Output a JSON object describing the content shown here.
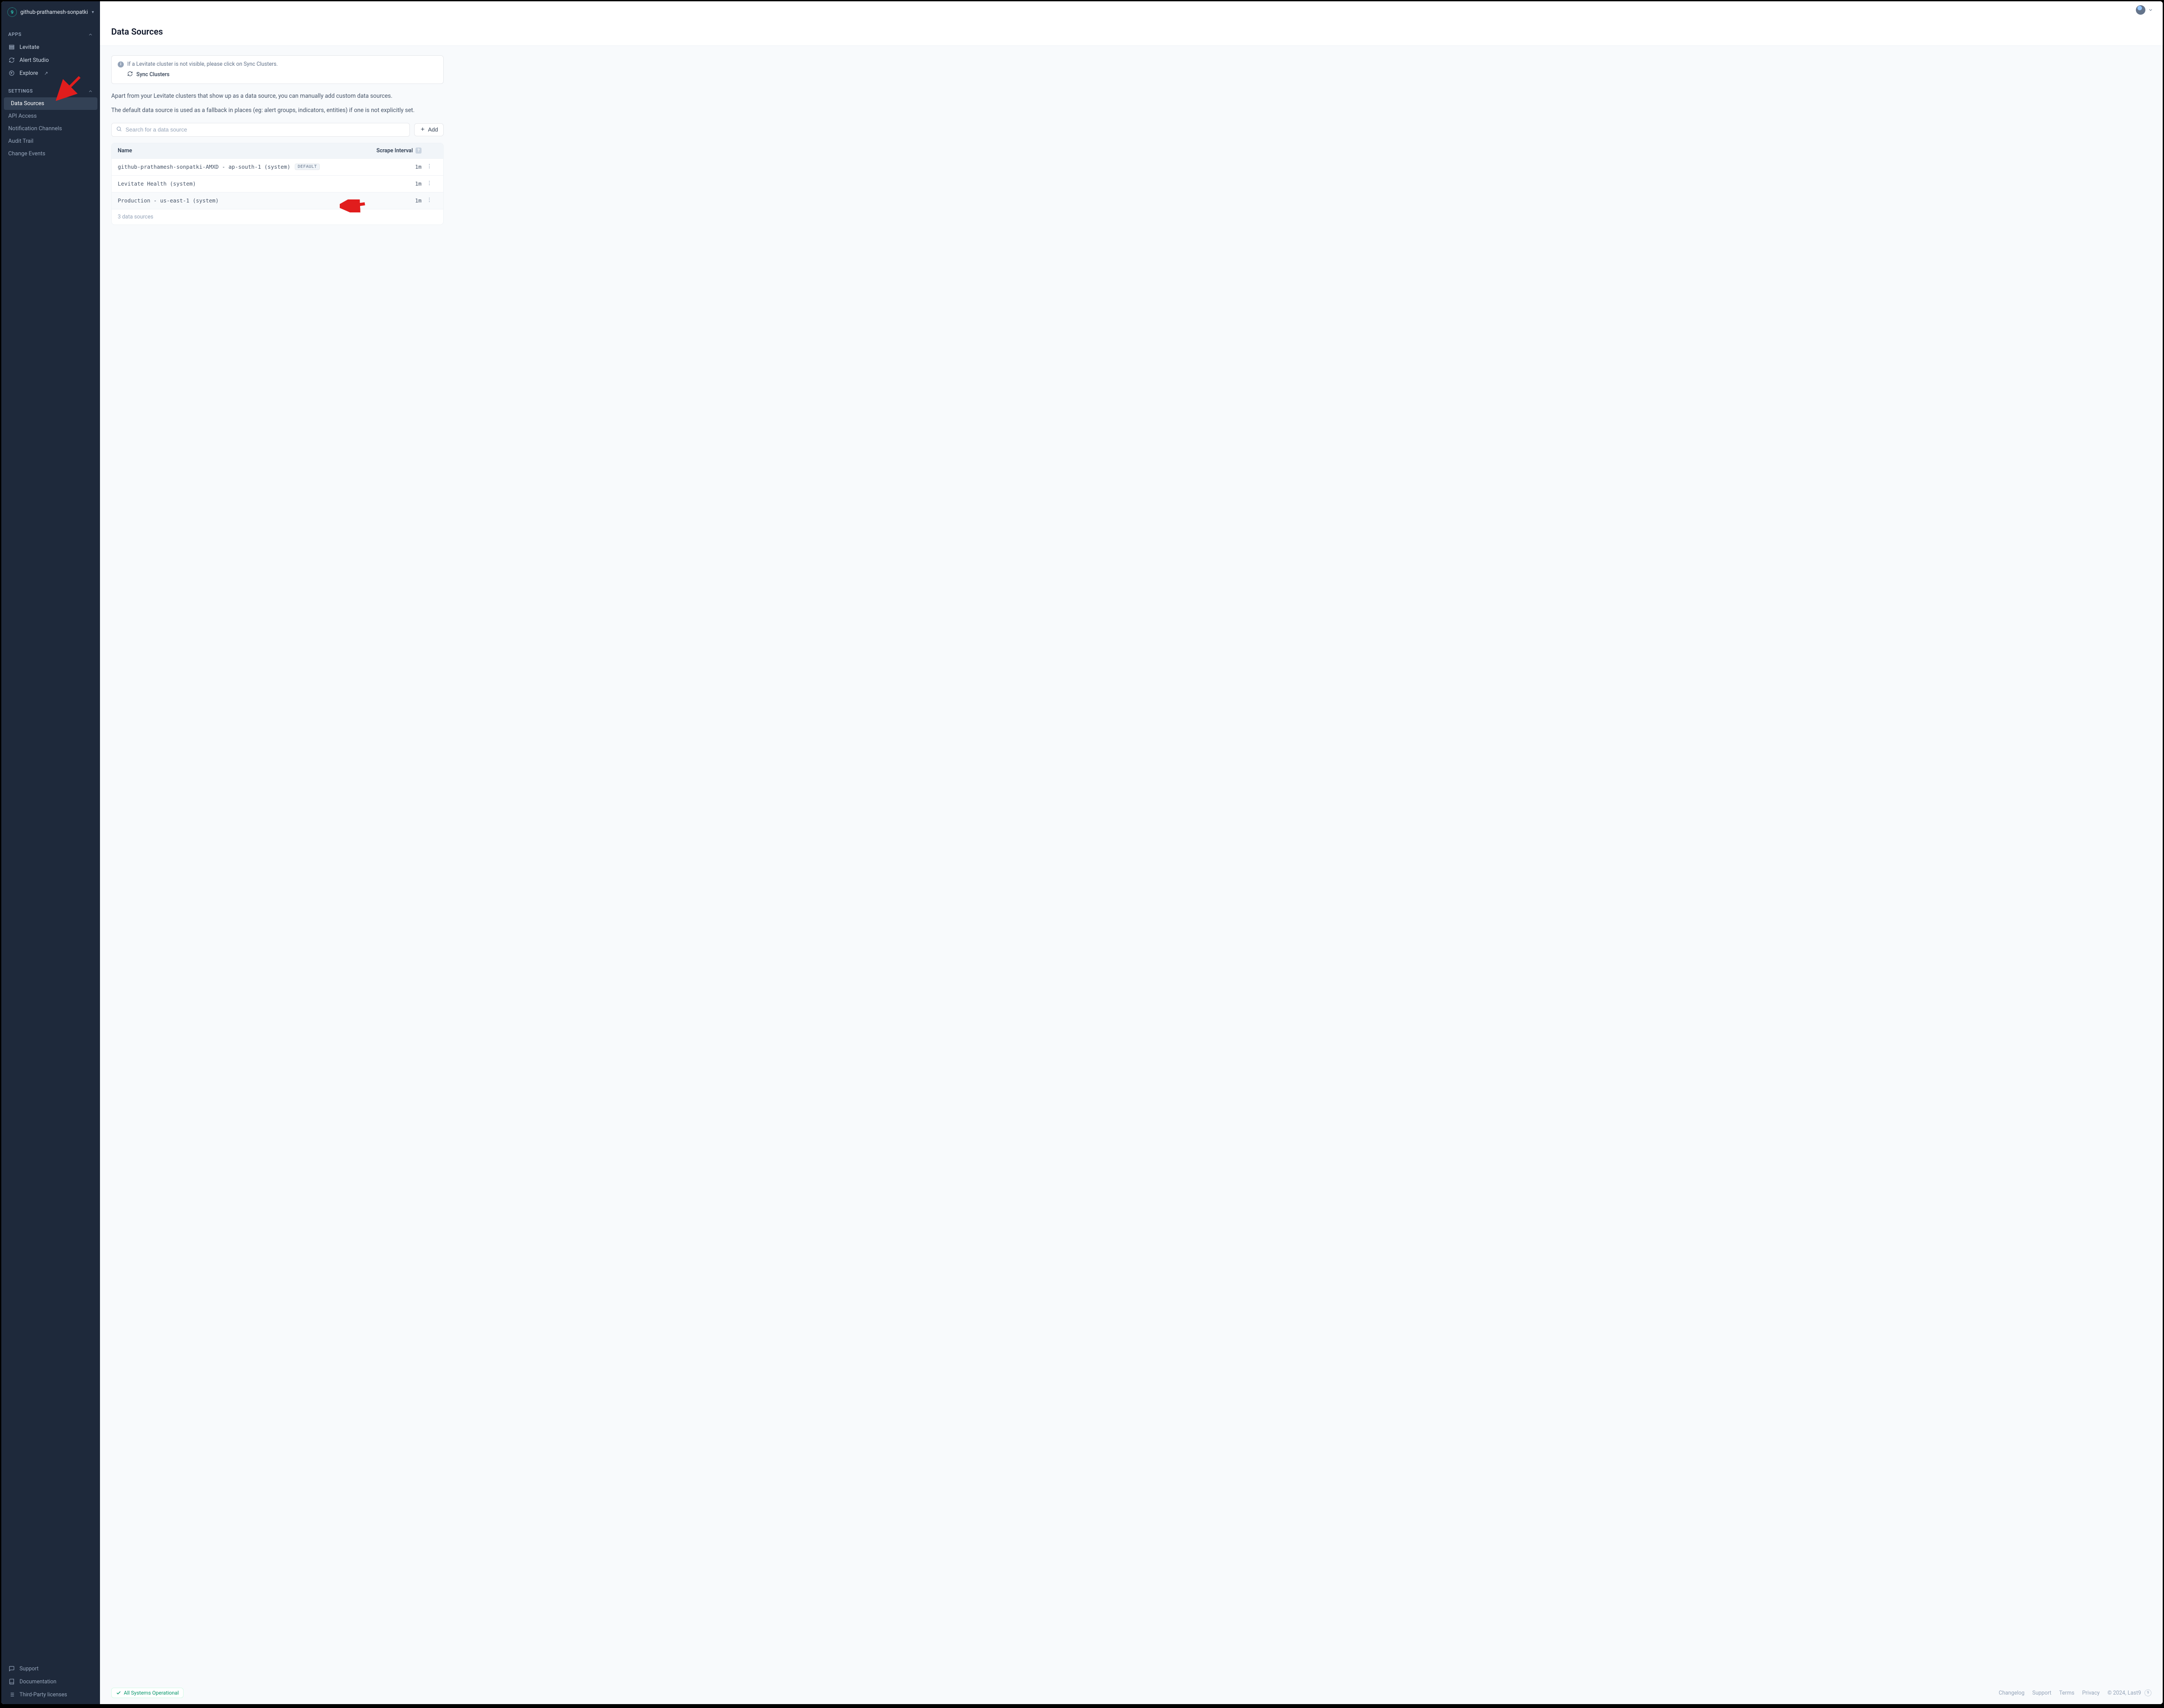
{
  "org": {
    "name": "github-prathamesh-sonpatki",
    "logo_glyph": "9"
  },
  "sidebar": {
    "apps_label": "APPS",
    "settings_label": "SETTINGS",
    "apps": [
      {
        "label": "Levitate"
      },
      {
        "label": "Alert Studio"
      },
      {
        "label": "Explore",
        "external": true
      }
    ],
    "settings": [
      {
        "label": "Data Sources",
        "active": true
      },
      {
        "label": "API Access"
      },
      {
        "label": "Notification Channels"
      },
      {
        "label": "Audit Trail"
      },
      {
        "label": "Change Events"
      }
    ],
    "footer": [
      {
        "label": "Support"
      },
      {
        "label": "Documentation"
      },
      {
        "label": "Third-Party licenses"
      }
    ]
  },
  "page": {
    "title": "Data Sources",
    "info_text": "If a Levitate cluster is not visible, please click on Sync Clusters.",
    "sync_label": "Sync Clusters",
    "p1": "Apart from your Levitate clusters that show up as a data source, you can manually add custom data sources.",
    "p2": "The default data source is used as a fallback in places (eg: alert groups, indicators, entities) if one is not explicitly set.",
    "search_placeholder": "Search for a data source",
    "add_label": "Add"
  },
  "table": {
    "col_name": "Name",
    "col_interval": "Scrape Interval",
    "rows": [
      {
        "name": "github-prathamesh-sonpatki-AMXD - ap-south-1 (system)",
        "default": true,
        "interval": "1m"
      },
      {
        "name": "Levitate Health (system)",
        "default": false,
        "interval": "1m"
      },
      {
        "name": "Production - us-east-1 (system)",
        "default": false,
        "interval": "1m"
      }
    ],
    "default_tag": "DEFAULT",
    "footer": "3 data sources"
  },
  "footer": {
    "status": "All Systems Operational",
    "links": [
      "Changelog",
      "Support",
      "Terms",
      "Privacy"
    ],
    "copyright": "© 2024, Last9",
    "logo_glyph": "9"
  }
}
